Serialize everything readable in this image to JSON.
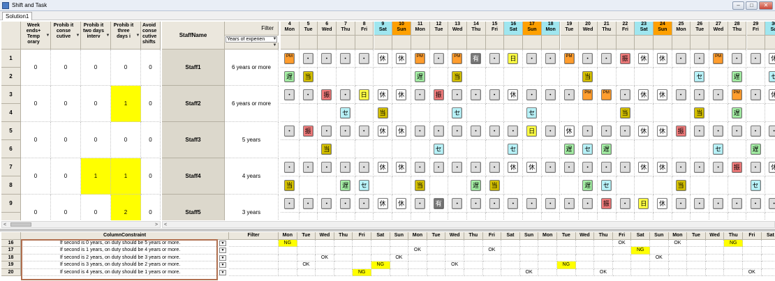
{
  "window": {
    "title": "Shift and Task",
    "tab": "Solution1",
    "min_glyph": "–",
    "max_glyph": "□",
    "close_glyph": "✕"
  },
  "columns": [
    {
      "label": "Week ends+ Temp orary"
    },
    {
      "label": "Prohib it conse cutive"
    },
    {
      "label": "Prohib it two days interv"
    },
    {
      "label": "Prohib it three days i"
    },
    {
      "label": "Avoid conse cutive shifts"
    }
  ],
  "headers": {
    "staff": "StaffName",
    "filter": "Filter",
    "filter_sub": "Years of experien",
    "column_constraint": "ColumnConstraint",
    "filter2": "Filter"
  },
  "days": [
    {
      "d": "4",
      "w": "Mon",
      "t": "n"
    },
    {
      "d": "5",
      "w": "Tue",
      "t": "n"
    },
    {
      "d": "6",
      "w": "Wed",
      "t": "n"
    },
    {
      "d": "7",
      "w": "Thu",
      "t": "n"
    },
    {
      "d": "8",
      "w": "Fri",
      "t": "n"
    },
    {
      "d": "9",
      "w": "Sat",
      "t": "sat"
    },
    {
      "d": "10",
      "w": "Sun",
      "t": "sun"
    },
    {
      "d": "11",
      "w": "Mon",
      "t": "n"
    },
    {
      "d": "12",
      "w": "Tue",
      "t": "n"
    },
    {
      "d": "13",
      "w": "Wed",
      "t": "n"
    },
    {
      "d": "14",
      "w": "Thu",
      "t": "n"
    },
    {
      "d": "15",
      "w": "Fri",
      "t": "n"
    },
    {
      "d": "16",
      "w": "Sat",
      "t": "sat"
    },
    {
      "d": "17",
      "w": "Sun",
      "t": "sun"
    },
    {
      "d": "18",
      "w": "Mon",
      "t": "hol"
    },
    {
      "d": "19",
      "w": "Tue",
      "t": "n"
    },
    {
      "d": "20",
      "w": "Wed",
      "t": "n"
    },
    {
      "d": "21",
      "w": "Thu",
      "t": "n"
    },
    {
      "d": "22",
      "w": "Fri",
      "t": "n"
    },
    {
      "d": "23",
      "w": "Sat",
      "t": "sat"
    },
    {
      "d": "24",
      "w": "Sun",
      "t": "sun"
    },
    {
      "d": "25",
      "w": "Mon",
      "t": "n"
    },
    {
      "d": "26",
      "w": "Tue",
      "t": "n"
    },
    {
      "d": "27",
      "w": "Wed",
      "t": "n"
    },
    {
      "d": "28",
      "w": "Thu",
      "t": "n"
    },
    {
      "d": "29",
      "w": "Fri",
      "t": "n"
    },
    {
      "d": "30",
      "w": "Sat",
      "t": "sat"
    }
  ],
  "staff": [
    {
      "row1": "1",
      "row2": "2",
      "name": "Staff1",
      "exp": "6 years or more",
      "vals": [
        "0",
        "0",
        "0",
        "0",
        "0"
      ],
      "hl": [
        false,
        false,
        false,
        false,
        false
      ],
      "shifts": [
        "PM",
        "・",
        "・",
        "・",
        "・",
        "休",
        "休",
        "PM",
        "・",
        "PM",
        "有",
        "・",
        "日",
        "・",
        "・",
        "PM",
        "・",
        "・",
        "振",
        "休",
        "休",
        "・",
        "・",
        "PM",
        "・",
        "・",
        "休"
      ],
      "tasks": [
        "遅",
        "当",
        "",
        "",
        "",
        "",
        "",
        "遅",
        "",
        "当",
        "",
        "",
        "",
        "",
        "",
        "",
        "当",
        "",
        "",
        "",
        "",
        "",
        "セ",
        "",
        "遅",
        "",
        "セ"
      ]
    },
    {
      "row1": "3",
      "row2": "4",
      "name": "Staff2",
      "exp": "6 years or more",
      "vals": [
        "0",
        "0",
        "0",
        "1",
        "0"
      ],
      "hl": [
        false,
        false,
        false,
        true,
        false
      ],
      "shifts": [
        "・",
        "・",
        "振",
        "・",
        "日",
        "休",
        "休",
        "・",
        "振",
        "・",
        "・",
        "・",
        "休",
        "・",
        "・",
        "・",
        "PM",
        "PM",
        "・",
        "休",
        "休",
        "・",
        "・",
        "・",
        "PM",
        "・",
        "休"
      ],
      "tasks": [
        "",
        "",
        "",
        "セ",
        "",
        "当",
        "",
        "",
        "",
        "セ",
        "",
        "",
        "",
        "セ",
        "",
        "",
        "",
        "",
        "当",
        "",
        "",
        "",
        "当",
        "",
        "遅",
        "",
        ""
      ]
    },
    {
      "row1": "5",
      "row2": "6",
      "name": "Staff3",
      "exp": "5 years",
      "vals": [
        "0",
        "0",
        "0",
        "0",
        "0"
      ],
      "hl": [
        false,
        false,
        false,
        false,
        false
      ],
      "shifts": [
        "・",
        "振",
        "・",
        "・",
        "・",
        "休",
        "休",
        "・",
        "・",
        "・",
        "・",
        "・",
        "・",
        "日",
        "・",
        "休",
        "・",
        "・",
        "・",
        "休",
        "休",
        "振",
        "・",
        "・",
        "・",
        "・",
        "・"
      ],
      "tasks": [
        "",
        "",
        "当",
        "",
        "",
        "",
        "",
        "",
        "セ",
        "",
        "",
        "",
        "セ",
        "",
        "",
        "遅",
        "セ",
        "遅",
        "",
        "",
        "",
        "",
        "",
        "セ",
        "",
        "遅",
        ""
      ]
    },
    {
      "row1": "7",
      "row2": "8",
      "name": "Staff4",
      "exp": "4 years",
      "vals": [
        "0",
        "0",
        "1",
        "1",
        "0"
      ],
      "hl": [
        false,
        false,
        true,
        true,
        false
      ],
      "shifts": [
        "・",
        "・",
        "・",
        "・",
        "・",
        "休",
        "休",
        "・",
        "・",
        "・",
        "・",
        "・",
        "休",
        "休",
        "・",
        "・",
        "・",
        "・",
        "・",
        "休",
        "休",
        "・",
        "・",
        "・",
        "振",
        "・",
        "休"
      ],
      "tasks": [
        "当",
        "",
        "",
        "遅",
        "セ",
        "",
        "",
        "当",
        "",
        "",
        "遅",
        "当",
        "",
        "",
        "",
        "",
        "遅",
        "セ",
        "",
        "",
        "",
        "当",
        "",
        "",
        "",
        "セ",
        ""
      ]
    },
    {
      "row1": "9",
      "row2": "",
      "name": "Staff5",
      "exp": "3 years",
      "vals": [
        "0",
        "0",
        "0",
        "2",
        "0"
      ],
      "hl": [
        false,
        false,
        false,
        true,
        false
      ],
      "shifts": [
        "・",
        "・",
        "・",
        "・",
        "・",
        "休",
        "休",
        "・",
        "有",
        "・",
        "・",
        "・",
        "・",
        "・",
        "・",
        "・",
        "・",
        "振",
        "・",
        "日",
        "休",
        "・",
        "・",
        "・",
        "・",
        "・",
        "・"
      ],
      "tasks": []
    }
  ],
  "constraints": [
    {
      "row": "16",
      "text": "If second is 0 years, on duty should be 5 years or more.",
      "res": {
        "0": "NG",
        "18": "OK",
        "21": "OK",
        "24": "NG"
      }
    },
    {
      "row": "17",
      "text": "If second is 1 years, on duty should be 4 years or more.",
      "res": {
        "7": "OK",
        "11": "OK",
        "19": "NG"
      }
    },
    {
      "row": "18",
      "text": "If second is 2 years, on duty should be 3 years or more.",
      "res": {
        "2": "OK",
        "6": "OK",
        "20": "OK"
      }
    },
    {
      "row": "19",
      "text": "If second is 3 years, on duty should be 2 years or more.",
      "res": {
        "1": "OK",
        "5": "NG",
        "9": "OK",
        "15": "NG"
      }
    },
    {
      "row": "20",
      "text": "If second is 4 years, on duty should be 1 years or more.",
      "res": {
        "4": "NG",
        "13": "OK",
        "17": "OK",
        "25": "OK"
      }
    }
  ],
  "colors": {
    "sat": "#9fe6ef",
    "sun": "#ffa000",
    "hol": "#9fe6ef",
    "PM": "#ff9d2e",
    "振": "#f07b7b",
    "休": "#ffffff",
    "有": "#777777",
    "日": "#ffff44",
    "・": "#dcdcdc",
    "遅": "#a6f0a6",
    "当": "#d4c000",
    "セ": "#b8f2f8"
  }
}
